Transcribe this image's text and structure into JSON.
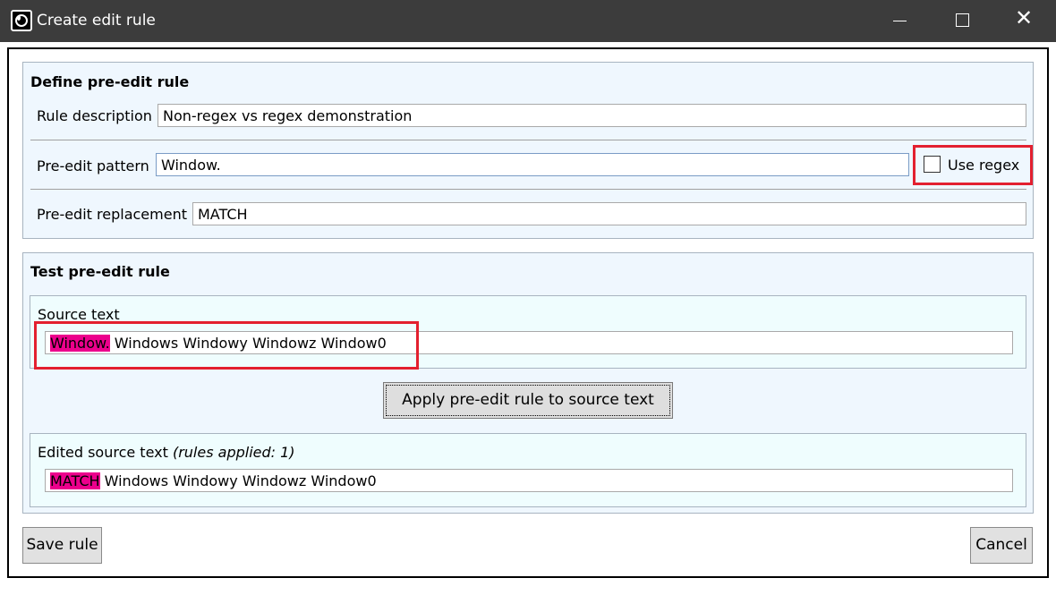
{
  "window": {
    "title": "Create edit rule",
    "controls": {
      "minimize": "minimize-icon",
      "maximize": "maximize-icon",
      "close": "close-icon"
    }
  },
  "define": {
    "title": "Define pre-edit rule",
    "rule_description_label": "Rule description",
    "rule_description_value": "Non-regex vs regex demonstration",
    "pattern_label": "Pre-edit pattern",
    "pattern_value": "Window.",
    "use_regex_label": "Use regex",
    "use_regex_checked": false,
    "replacement_label": "Pre-edit replacement",
    "replacement_value": "MATCH"
  },
  "test": {
    "title": "Test pre-edit rule",
    "source_label": "Source text",
    "source_match": "Window.",
    "source_rest": " Windows Windowy Windowz Window0",
    "apply_button": "Apply pre-edit rule to source text",
    "edited_label": "Edited source text",
    "edited_note": "(rules applied: 1)",
    "edited_match": "MATCH",
    "edited_rest": " Windows Windowy Windowz Window0"
  },
  "footer": {
    "save_label": "Save rule",
    "cancel_label": "Cancel"
  },
  "colors": {
    "titlebar": "#3c3c3c",
    "highlight": "#ec008c",
    "annotation_red": "#e3202f",
    "panel_bg": "#eff7fe"
  }
}
